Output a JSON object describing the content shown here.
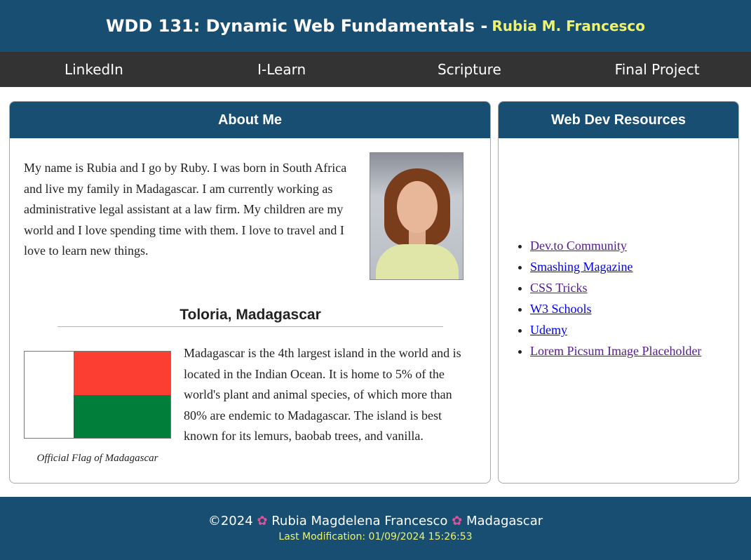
{
  "header": {
    "course": "WDD 131: Dynamic Web Fundamentals - ",
    "name": "Rubia M. Francesco"
  },
  "nav": [
    "LinkedIn",
    "I-Learn",
    "Scripture",
    "Final Project"
  ],
  "about": {
    "title": "About Me",
    "text": "My name is Rubia and I go by Ruby. I was born in South Africa and live my family in Madagascar. I am currently working as administrative legal assistant at a law firm. My children are my world and I love spending time with them. I love to travel and I love to learn new things.",
    "place_title": "Toloria, Madagascar",
    "flag_caption": "Official Flag of Madagascar",
    "place_text": "Madagascar is the 4th largest island in the world and is located in the Indian Ocean. It is home to 5% of the world's plant and animal species, of which more than 80% are endemic to Madagascar. The island is best known for its lemurs, baobab trees, and vanilla.",
    "flag_colors": {
      "white": "#ffffff",
      "red": "#fc3d32",
      "green": "#007e3a"
    }
  },
  "resources": {
    "title": "Web Dev Resources",
    "links": [
      "Dev.to Community",
      "Smashing Magazine",
      "CSS Tricks",
      "W3 Schools",
      "Udemy",
      "Lorem Picsum Image Placeholder"
    ]
  },
  "footer": {
    "copyright": "©2024",
    "name": "Rubia Magdelena Francesco",
    "country": "Madagascar",
    "flower_icon": "hibiscus-icon",
    "last_modified": "Last Modification: 01/09/2024 15:26:53"
  },
  "colors": {
    "primary": "#174e72",
    "nav": "#333333",
    "accent": "#f0f36a"
  }
}
